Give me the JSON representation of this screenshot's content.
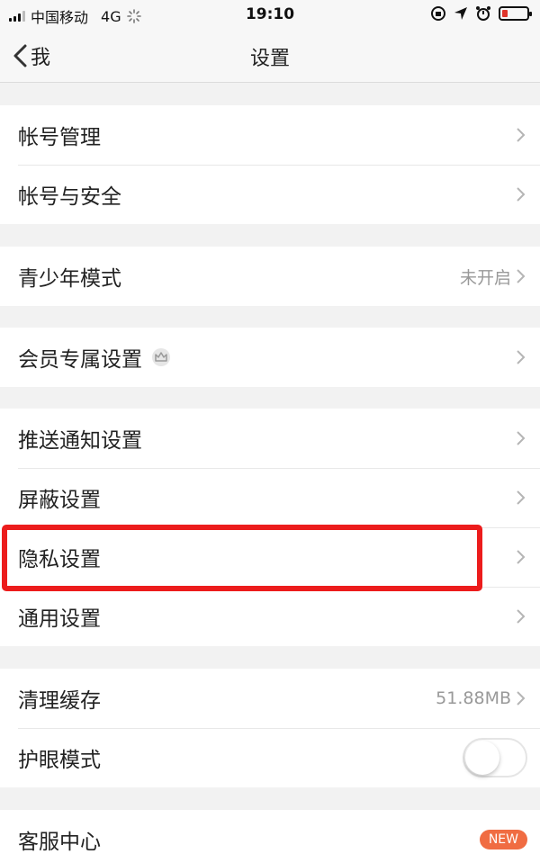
{
  "status_bar": {
    "carrier": "中国移动",
    "network": "4G",
    "time": "19:10"
  },
  "nav": {
    "back_label": "我",
    "title": "设置"
  },
  "groups": [
    {
      "rows": [
        {
          "label": "帐号管理"
        },
        {
          "label": "帐号与安全"
        }
      ]
    },
    {
      "rows": [
        {
          "label": "青少年模式",
          "value": "未开启"
        }
      ]
    },
    {
      "rows": [
        {
          "label": "会员专属设置"
        }
      ]
    },
    {
      "rows": [
        {
          "label": "推送通知设置"
        },
        {
          "label": "屏蔽设置"
        },
        {
          "label": "隐私设置"
        },
        {
          "label": "通用设置"
        }
      ]
    },
    {
      "rows": [
        {
          "label": "清理缓存",
          "value": "51.88MB"
        },
        {
          "label": "护眼模式",
          "toggle": false
        }
      ]
    },
    {
      "rows": [
        {
          "label": "客服中心",
          "badge": "NEW"
        }
      ]
    }
  ],
  "colors": {
    "highlight": "#ec1c1c",
    "badge": "#f06c42",
    "battery_low": "#e0352b"
  }
}
